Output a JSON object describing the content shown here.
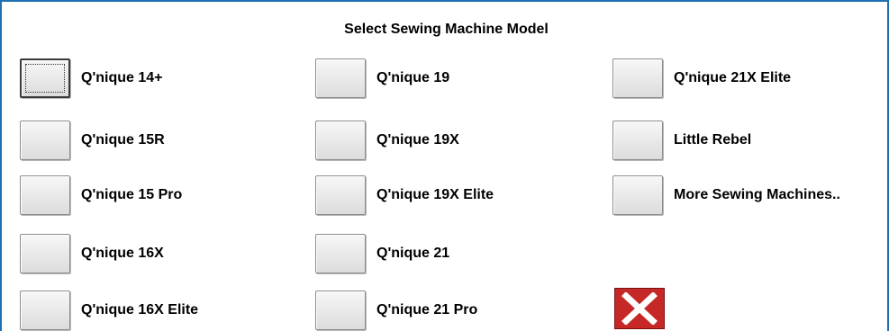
{
  "dialog": {
    "title": "Select Sewing Machine Model"
  },
  "models": [
    {
      "label": "Q'nique 14+"
    },
    {
      "label": "Q'nique 15R"
    },
    {
      "label": "Q'nique 15 Pro"
    },
    {
      "label": "Q'nique 16X"
    },
    {
      "label": "Q'nique 16X Elite"
    },
    {
      "label": "Q'nique 19"
    },
    {
      "label": "Q'nique 19X"
    },
    {
      "label": "Q'nique 19X Elite"
    },
    {
      "label": "Q'nique 21"
    },
    {
      "label": "Q'nique 21 Pro"
    },
    {
      "label": "Q'nique 21X Elite"
    },
    {
      "label": "Little Rebel"
    },
    {
      "label": "More Sewing Machines.."
    }
  ],
  "close_button": {
    "icon": "close-x-icon",
    "color": "#c62828"
  },
  "colors": {
    "frame_border": "#1f6fb2"
  }
}
